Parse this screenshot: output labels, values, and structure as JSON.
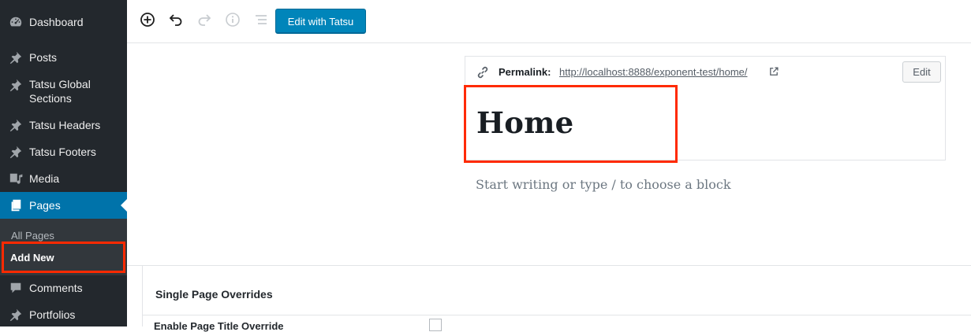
{
  "sidebar": {
    "items": [
      {
        "label": "Dashboard",
        "icon": "dashboard-icon"
      },
      {
        "label": "Posts",
        "icon": "pin-icon"
      },
      {
        "label": "Tatsu Global Sections",
        "icon": "pin-icon"
      },
      {
        "label": "Tatsu Headers",
        "icon": "pin-icon"
      },
      {
        "label": "Tatsu Footers",
        "icon": "pin-icon"
      },
      {
        "label": "Media",
        "icon": "media-icon"
      },
      {
        "label": "Pages",
        "icon": "pages-icon",
        "active": true
      },
      {
        "label": "Comments",
        "icon": "comments-icon"
      },
      {
        "label": "Portfolios",
        "icon": "pin-icon"
      }
    ],
    "pages_submenu": [
      {
        "label": "All Pages"
      },
      {
        "label": "Add New",
        "current": true
      }
    ],
    "colors": {
      "background": "#23282d",
      "active": "#0073aa",
      "highlight": "#ff2a00"
    }
  },
  "toolbar": {
    "icons": [
      "add-block-icon",
      "undo-icon",
      "redo-icon",
      "info-icon",
      "outline-icon"
    ],
    "tatsu_label": "Edit with Tatsu",
    "accent": "#0085ba"
  },
  "editor": {
    "permalink_label": "Permalink:",
    "permalink_url": "http://localhost:8888/exponent-test/home/",
    "edit_label": "Edit",
    "title": "Home",
    "placeholder": "Start writing or type / to choose a block"
  },
  "meta_box": {
    "title": "Single Page Overrides",
    "field_label": "Enable Page Title Override"
  }
}
